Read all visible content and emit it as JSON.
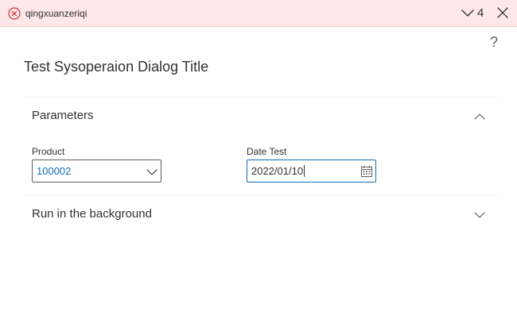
{
  "banner": {
    "message": "qingxuanzeriqi",
    "count": "4",
    "icon": "error-circle-icon",
    "background": "#fde7e9",
    "icon_color": "#d13438"
  },
  "dialog": {
    "title": "Test Sysoperaion Dialog Title",
    "help_glyph": "?"
  },
  "sections": {
    "parameters": {
      "title": "Parameters",
      "expanded": true
    },
    "background": {
      "title": "Run in the background",
      "expanded": false
    }
  },
  "fields": {
    "product": {
      "label": "Product",
      "value": "100002"
    },
    "date_test": {
      "label": "Date Test",
      "value": "2022/01/10"
    }
  },
  "colors": {
    "accent": "#0f6cbd",
    "text": "#323130"
  }
}
